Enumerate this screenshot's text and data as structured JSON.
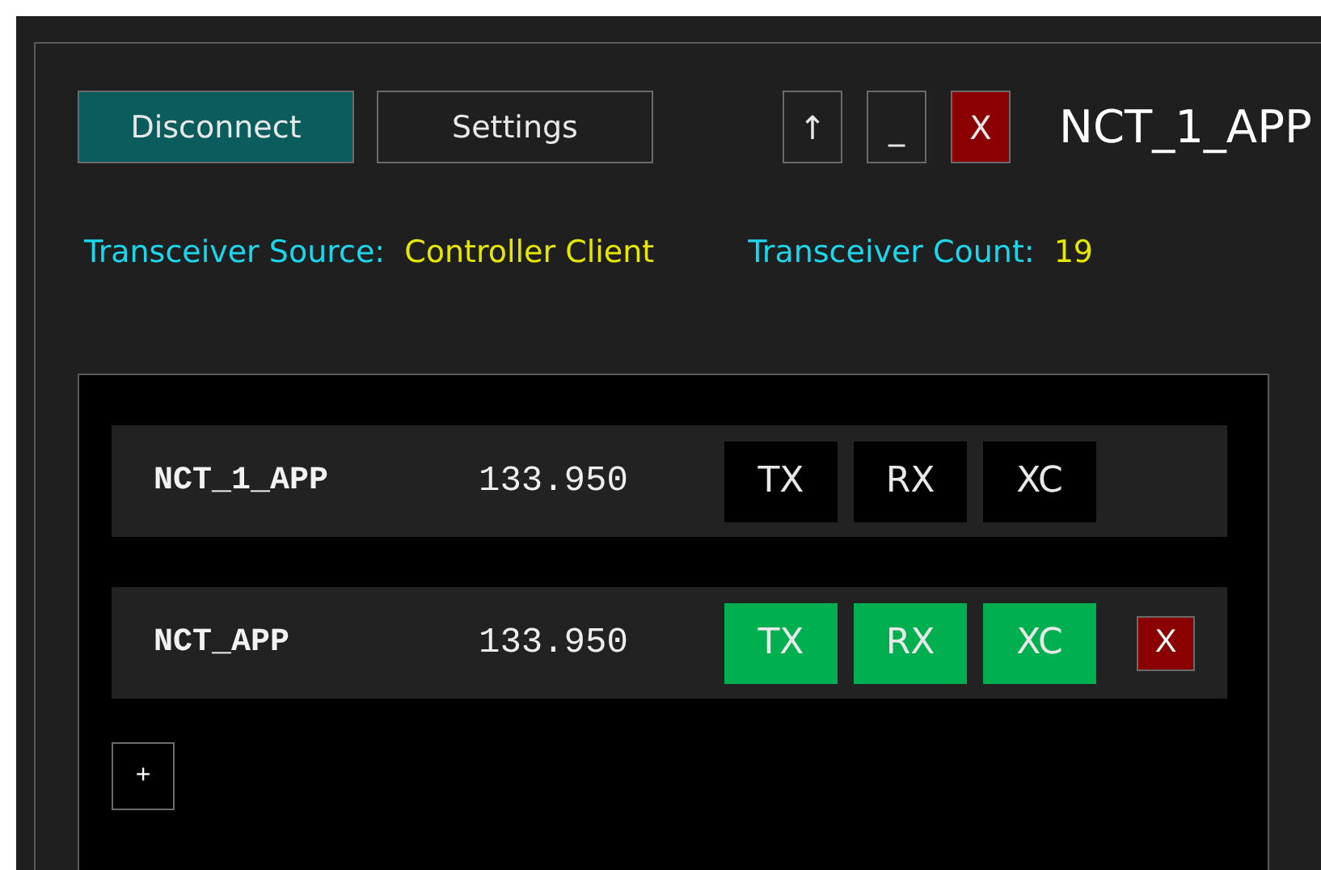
{
  "toolbar": {
    "buttons": [
      {
        "label": "Disconnect",
        "kind": "primary"
      },
      {
        "label": "Settings",
        "kind": "normal"
      }
    ],
    "window_buttons": [
      {
        "label": "↑",
        "kind": "normal"
      },
      {
        "label": "_",
        "kind": "normal"
      },
      {
        "label": "X",
        "kind": "danger"
      }
    ],
    "title": "NCT_1_APP"
  },
  "info": [
    {
      "label": "Transceiver Source:",
      "value": "Controller Client"
    },
    {
      "label": "Transceiver Count:",
      "value": "19"
    }
  ],
  "stations": [
    {
      "name": "NCT_1_APP",
      "frequency": "133.950",
      "toggles": [
        {
          "label": "TX",
          "on": false
        },
        {
          "label": "RX",
          "on": false
        },
        {
          "label": "XC",
          "on": false
        }
      ]
    },
    {
      "name": "NCT_APP",
      "frequency": "133.950",
      "toggles": [
        {
          "label": "TX",
          "on": true
        },
        {
          "label": "RX",
          "on": true
        },
        {
          "label": "XC",
          "on": true
        }
      ],
      "remove_button": "X"
    }
  ],
  "add_button": "+"
}
